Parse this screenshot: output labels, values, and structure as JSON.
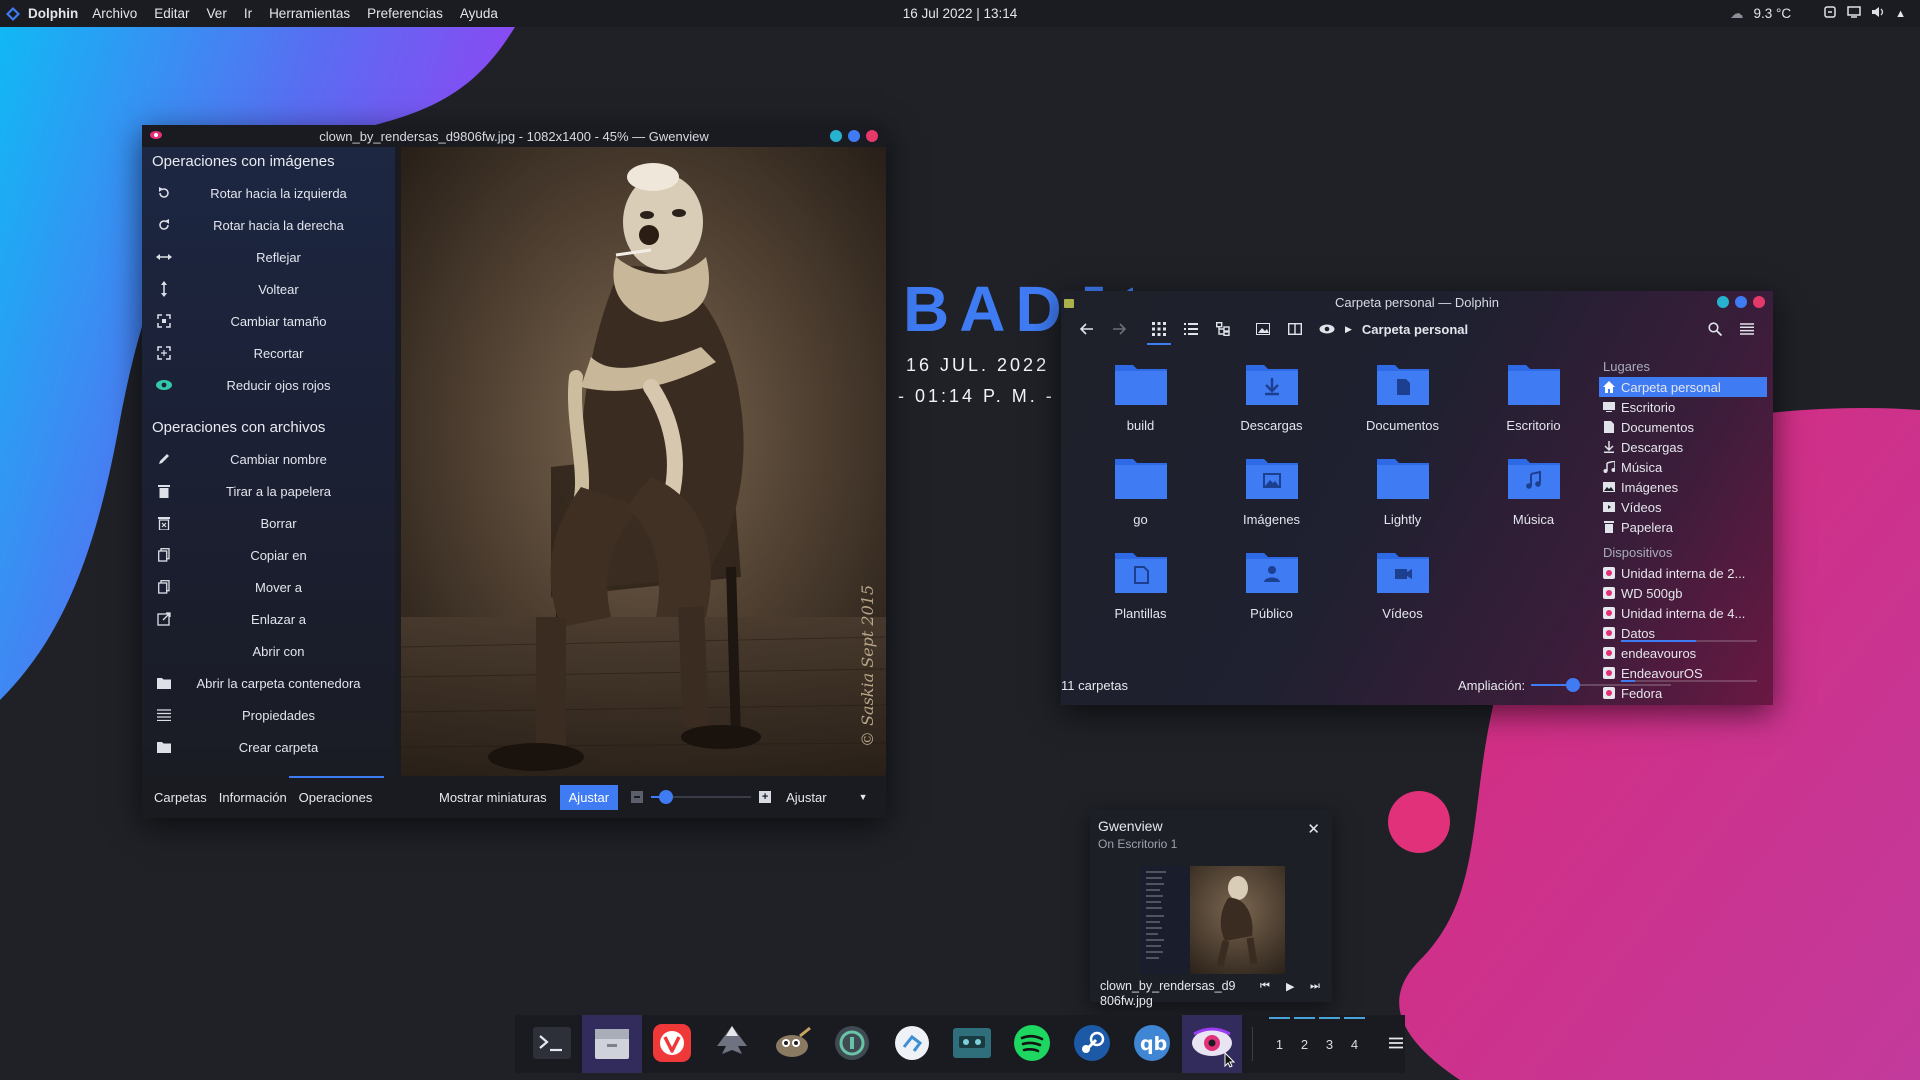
{
  "topbar": {
    "app_name": "Dolphin",
    "menu": [
      "Archivo",
      "Editar",
      "Ver",
      "Ir",
      "Herramientas",
      "Preferencias",
      "Ayuda"
    ],
    "datetime": "16 Jul 2022 | 13:14",
    "temperature": "9.3 °C"
  },
  "desktop": {
    "logo_text": "BADJO",
    "date": "16 JUL. 2022",
    "time": "- 01:14 P. M. -"
  },
  "gwenview": {
    "title": "clown_by_rendersas_d9806fw.jpg - 1082x1400 - 45% — Gwenview",
    "image_ops_heading": "Operaciones con imágenes",
    "image_ops": [
      {
        "label": "Rotar hacia la izquierda",
        "icon": "rotate-left-icon"
      },
      {
        "label": "Rotar hacia la derecha",
        "icon": "rotate-right-icon"
      },
      {
        "label": "Reflejar",
        "icon": "mirror-icon"
      },
      {
        "label": "Voltear",
        "icon": "flip-icon"
      },
      {
        "label": "Cambiar tamaño",
        "icon": "resize-icon"
      },
      {
        "label": "Recortar",
        "icon": "crop-icon"
      },
      {
        "label": "Reducir ojos rojos",
        "icon": "red-eye-icon"
      }
    ],
    "file_ops_heading": "Operaciones con archivos",
    "file_ops": [
      {
        "label": "Cambiar nombre",
        "icon": "rename-icon"
      },
      {
        "label": "Tirar a la papelera",
        "icon": "trash-icon"
      },
      {
        "label": "Borrar",
        "icon": "delete-icon"
      },
      {
        "label": "Copiar en",
        "icon": "copy-icon"
      },
      {
        "label": "Mover a",
        "icon": "move-icon"
      },
      {
        "label": "Enlazar a",
        "icon": "link-icon"
      },
      {
        "label": "Abrir con",
        "icon": ""
      },
      {
        "label": "Abrir la carpeta contenedora",
        "icon": "folder-icon"
      },
      {
        "label": "Propiedades",
        "icon": "properties-icon"
      },
      {
        "label": "Crear carpeta",
        "icon": "folder-icon"
      }
    ],
    "tabs": [
      "Carpetas",
      "Información",
      "Operaciones"
    ],
    "active_tab": "Operaciones",
    "show_thumbnails": "Mostrar miniaturas",
    "fit_button": "Ajustar",
    "zoom_select": "Ajustar",
    "zoom_level": 0.15,
    "watermark": "© Saskia Sept 2015"
  },
  "dolphin": {
    "title": "Carpeta personal — Dolphin",
    "breadcrumb": "Carpeta personal",
    "folders": [
      {
        "name": "build",
        "icon": "folder-icon"
      },
      {
        "name": "Descargas",
        "icon": "download-folder-icon"
      },
      {
        "name": "Documentos",
        "icon": "documents-folder-icon"
      },
      {
        "name": "Escritorio",
        "icon": "desktop-folder-icon"
      },
      {
        "name": "go",
        "icon": "folder-icon"
      },
      {
        "name": "Imágenes",
        "icon": "pictures-folder-icon"
      },
      {
        "name": "Lightly",
        "icon": "folder-icon"
      },
      {
        "name": "Música",
        "icon": "music-folder-icon"
      },
      {
        "name": "Plantillas",
        "icon": "templates-folder-icon"
      },
      {
        "name": "Público",
        "icon": "public-folder-icon"
      },
      {
        "name": "Vídeos",
        "icon": "videos-folder-icon"
      }
    ],
    "places_heading": "Lugares",
    "places": [
      "Carpeta personal",
      "Escritorio",
      "Documentos",
      "Descargas",
      "Música",
      "Imágenes",
      "Vídeos",
      "Papelera"
    ],
    "devices_heading": "Dispositivos",
    "devices": [
      {
        "name": "Unidad interna de 2...",
        "usage": null
      },
      {
        "name": "WD 500gb",
        "usage": null
      },
      {
        "name": "Unidad interna de 4...",
        "usage": null
      },
      {
        "name": "Datos",
        "usage": 0.55
      },
      {
        "name": "endeavouros",
        "usage": null
      },
      {
        "name": "EndeavourOS",
        "usage": 0.1
      },
      {
        "name": "Fedora",
        "usage": null
      }
    ],
    "status": "11 carpetas",
    "zoom_label": "Ampliación:",
    "zoom_level": 0.3
  },
  "notification": {
    "app": "Gwenview",
    "subtitle": "On Escritorio 1",
    "filename_line1": "clown_by_rendersas_d9",
    "filename_line2": "806fw.jpg"
  },
  "dock": {
    "apps": [
      "terminal-icon",
      "file-manager-icon",
      "vivaldi-icon",
      "inkscape-icon",
      "gimp-icon",
      "keepass-icon",
      "kde-connect-icon",
      "cassette-icon",
      "spotify-icon",
      "steam-icon",
      "qbittorrent-icon",
      "gwenview-icon"
    ],
    "desktops": [
      "1",
      "2",
      "3",
      "4"
    ]
  },
  "colors": {
    "accent": "#3f7bf3",
    "close": "#e5396a",
    "minimize": "#27b3cf",
    "maximize": "#3f7bf3",
    "pink": "#e0317a"
  }
}
